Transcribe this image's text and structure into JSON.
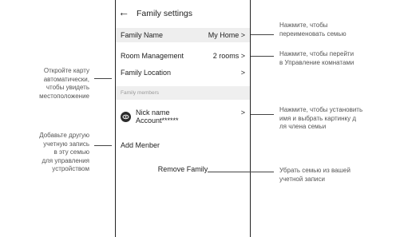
{
  "screen": {
    "title": "Family settings",
    "back_icon": "←"
  },
  "rows": {
    "family_name": {
      "label": "Family Name",
      "value": "My Home >"
    },
    "room_management": {
      "label": "Room Management",
      "value": "2 rooms >"
    },
    "family_location": {
      "label": "Family Location",
      "value": ">"
    },
    "family_members_header": "Family members",
    "member": {
      "name": "Nick name",
      "account": "Account******",
      "chevron": ">"
    },
    "add_member": "Add Menber",
    "remove_family": "Remove Family"
  },
  "annotations": {
    "rename": [
      "Нажмите, чтобы",
      "переименовать семью"
    ],
    "rooms": [
      "Нажмите, чтобы перейти",
      "в Управление комнатами"
    ],
    "location": [
      "Откройте карту",
      "автоматически,",
      "чтобы увидеть",
      "местоположение"
    ],
    "member": [
      "Нажмите, чтобы установить",
      "имя и выбрать картинку д",
      "ля члена семьи"
    ],
    "add": [
      "Добавьте другую",
      "учетную запись",
      "в эту семью",
      "для управления",
      "устройством"
    ],
    "remove": [
      "Убрать семью из вашей",
      "учетной записи"
    ]
  }
}
